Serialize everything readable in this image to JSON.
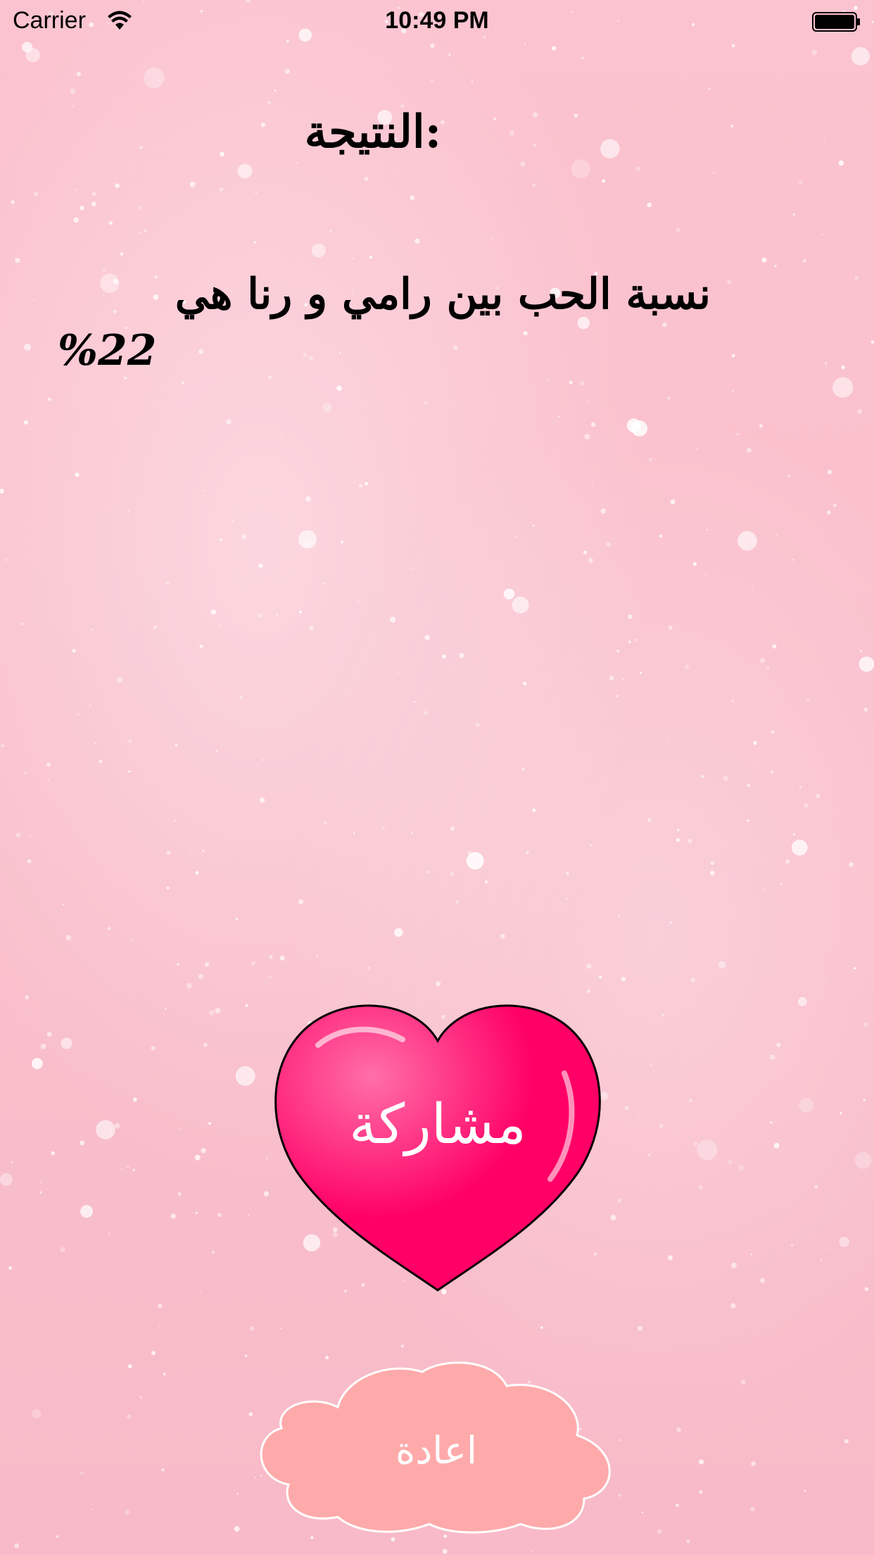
{
  "status_bar": {
    "carrier": "Carrier",
    "time": "10:49 PM",
    "wifi_icon": "wifi-icon",
    "battery_icon": "battery-icon"
  },
  "result": {
    "title": "النتيجة:",
    "message": "نسبة الحب بين رامي و رنا هي",
    "percentage": "%22"
  },
  "buttons": {
    "share_label": "مشاركة",
    "replay_label": "اعادة"
  },
  "colors": {
    "background": "#f9c6d1",
    "heart": "#ff0066",
    "cloud": "#ffaaaa"
  }
}
